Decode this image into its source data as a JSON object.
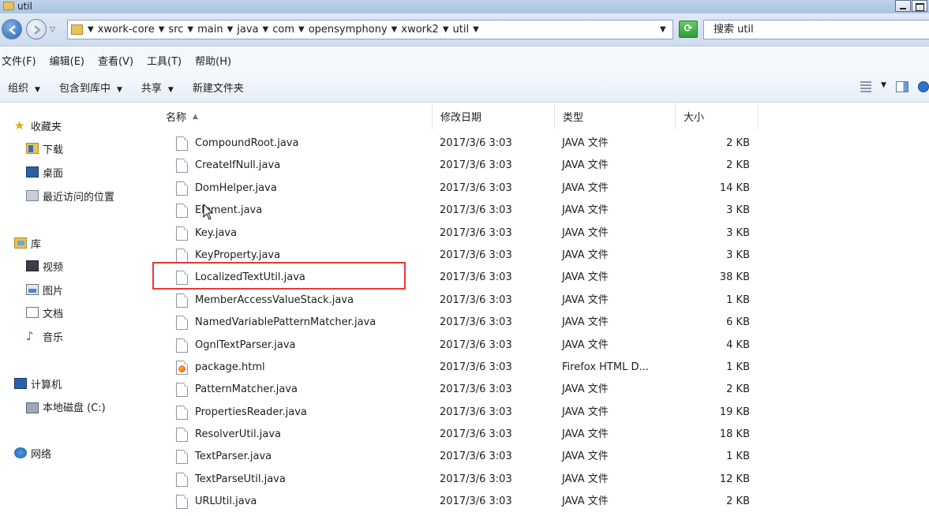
{
  "window": {
    "title": "util"
  },
  "address": {
    "crumbs": [
      "xwork-core",
      "src",
      "main",
      "java",
      "com",
      "opensymphony",
      "xwork2",
      "util"
    ]
  },
  "search": {
    "placeholder": "搜索 util"
  },
  "menu": [
    "文件(F)",
    "编辑(E)",
    "查看(V)",
    "工具(T)",
    "帮助(H)"
  ],
  "toolbar": {
    "organize": "组织",
    "include_library": "包含到库中",
    "share": "共享",
    "new_folder": "新建文件夹"
  },
  "nav": {
    "favorites": "收藏夹",
    "downloads": "下载",
    "desktop": "桌面",
    "recent": "最近访问的位置",
    "libraries": "库",
    "videos": "视频",
    "pictures": "图片",
    "documents": "文档",
    "music": "音乐",
    "computer": "计算机",
    "local_disk": "本地磁盘 (C:)",
    "network": "网络"
  },
  "columns": {
    "name": "名称",
    "date": "修改日期",
    "type": "类型",
    "size": "大小"
  },
  "files": [
    {
      "name": "CompoundRoot.java",
      "date": "2017/3/6 3:03",
      "type": "JAVA 文件",
      "size": "2 KB",
      "icon": "file-icon"
    },
    {
      "name": "CreateIfNull.java",
      "date": "2017/3/6 3:03",
      "type": "JAVA 文件",
      "size": "2 KB",
      "icon": "file-icon"
    },
    {
      "name": "DomHelper.java",
      "date": "2017/3/6 3:03",
      "type": "JAVA 文件",
      "size": "14 KB",
      "icon": "file-icon"
    },
    {
      "name": "Element.java",
      "date": "2017/3/6 3:03",
      "type": "JAVA 文件",
      "size": "3 KB",
      "icon": "file-icon"
    },
    {
      "name": "Key.java",
      "date": "2017/3/6 3:03",
      "type": "JAVA 文件",
      "size": "3 KB",
      "icon": "file-icon"
    },
    {
      "name": "KeyProperty.java",
      "date": "2017/3/6 3:03",
      "type": "JAVA 文件",
      "size": "3 KB",
      "icon": "file-icon"
    },
    {
      "name": "LocalizedTextUtil.java",
      "date": "2017/3/6 3:03",
      "type": "JAVA 文件",
      "size": "38 KB",
      "icon": "file-icon"
    },
    {
      "name": "MemberAccessValueStack.java",
      "date": "2017/3/6 3:03",
      "type": "JAVA 文件",
      "size": "1 KB",
      "icon": "file-icon"
    },
    {
      "name": "NamedVariablePatternMatcher.java",
      "date": "2017/3/6 3:03",
      "type": "JAVA 文件",
      "size": "6 KB",
      "icon": "file-icon"
    },
    {
      "name": "OgnlTextParser.java",
      "date": "2017/3/6 3:03",
      "type": "JAVA 文件",
      "size": "4 KB",
      "icon": "file-icon"
    },
    {
      "name": "package.html",
      "date": "2017/3/6 3:03",
      "type": "Firefox HTML D...",
      "size": "1 KB",
      "icon": "firefox-html-icon"
    },
    {
      "name": "PatternMatcher.java",
      "date": "2017/3/6 3:03",
      "type": "JAVA 文件",
      "size": "2 KB",
      "icon": "file-icon"
    },
    {
      "name": "PropertiesReader.java",
      "date": "2017/3/6 3:03",
      "type": "JAVA 文件",
      "size": "19 KB",
      "icon": "file-icon"
    },
    {
      "name": "ResolverUtil.java",
      "date": "2017/3/6 3:03",
      "type": "JAVA 文件",
      "size": "18 KB",
      "icon": "file-icon"
    },
    {
      "name": "TextParser.java",
      "date": "2017/3/6 3:03",
      "type": "JAVA 文件",
      "size": "1 KB",
      "icon": "file-icon"
    },
    {
      "name": "TextParseUtil.java",
      "date": "2017/3/6 3:03",
      "type": "JAVA 文件",
      "size": "12 KB",
      "icon": "file-icon"
    },
    {
      "name": "URLUtil.java",
      "date": "2017/3/6 3:03",
      "type": "JAVA 文件",
      "size": "2 KB",
      "icon": "file-icon"
    }
  ],
  "highlight_color": "#e53935"
}
